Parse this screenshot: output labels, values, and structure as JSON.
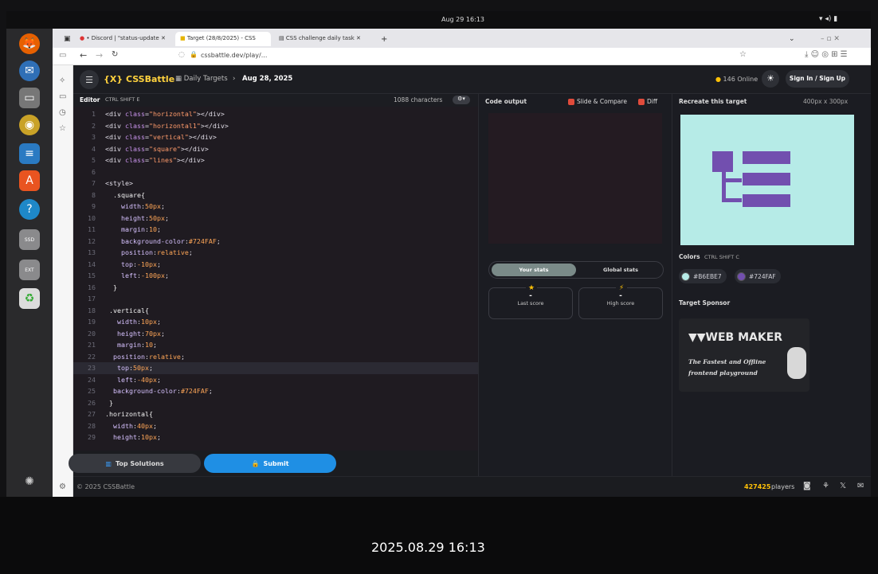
{
  "system": {
    "clock": "Aug 29  16:13"
  },
  "photo_stamp": "2025.08.29 16:13",
  "browser": {
    "tabs": [
      {
        "label": "• Discord | \"status-update"
      },
      {
        "label": "Target (28/8/2025) - CSS"
      },
      {
        "label": "CSS challenge daily task"
      }
    ],
    "url": "cssbattle.dev/play/..."
  },
  "app": {
    "logo": "{X} CSSBattle",
    "breadcrumb": {
      "section": "Daily Targets",
      "date": "Aug 28, 2025"
    },
    "online": "146 Online",
    "signin": "Sign In / Sign Up",
    "editor": {
      "title": "Editor",
      "shortcut": [
        "CTRL",
        "SHIFT",
        "E"
      ],
      "chars": "1088 characters",
      "lines": [
        "<div class=\"horizontal\"></div>",
        "<div class=\"horizontal1\"></div>",
        "<div class=\"vertical\"></div>",
        "<div class=\"square\"></div>",
        "<div class=\"lines\"></div>",
        "",
        "<style>",
        "  .square{",
        "    width:50px;",
        "    height:50px;",
        "    margin:10;",
        "    background-color:#724FAF;",
        "    position:relative;",
        "    top:-10px;",
        "    left:-100px;",
        "  }",
        "",
        " .vertical{",
        "   width:10px;",
        "   height:70px;",
        "   margin:10;",
        "  position:relative;",
        "   top:50px;",
        "   left:-40px;",
        "  background-color:#724FAF;",
        " }",
        ".horizontal{",
        "  width:40px;",
        "  height:10px;"
      ]
    },
    "buttons": {
      "top_solutions": "Top Solutions",
      "submit": "Submit"
    },
    "output": {
      "title": "Code output",
      "slide_compare": "Slide & Compare",
      "diff": "Diff",
      "tabs": [
        "Your stats",
        "Global stats"
      ],
      "last_score": {
        "value": "-",
        "label": "Last score"
      },
      "high_score": {
        "value": "-",
        "label": "High score"
      }
    },
    "target": {
      "title": "Recreate this target",
      "size": "400px x 300px",
      "colors_title": "Colors",
      "colors_shortcut": [
        "CTRL",
        "SHIFT",
        "C"
      ],
      "colors": [
        "#B6EBE7",
        "#724FAF"
      ],
      "sponsor_title": "Target Sponsor",
      "sponsor_name": "WEB MAKER",
      "sponsor_tagline_1": "The Fastest and Offline",
      "sponsor_tagline_2": "frontend playground"
    },
    "footer": {
      "copyright": "© 2025 CSSBattle",
      "players_count": "427425",
      "players_label": "players"
    }
  }
}
